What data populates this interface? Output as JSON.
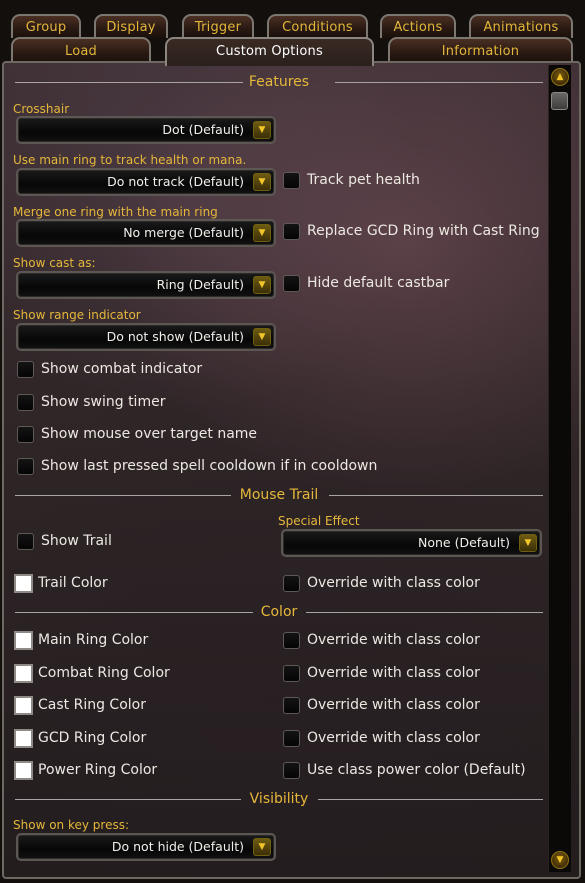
{
  "tabs": {
    "row1": [
      {
        "label": "Group"
      },
      {
        "label": "Display"
      },
      {
        "label": "Trigger"
      },
      {
        "label": "Conditions"
      },
      {
        "label": "Actions"
      },
      {
        "label": "Animations"
      }
    ],
    "row2": [
      {
        "label": "Load"
      },
      {
        "label": "Custom Options"
      },
      {
        "label": "Information"
      }
    ]
  },
  "sections": {
    "features": "Features",
    "mouse_trail": "Mouse Trail",
    "color": "Color",
    "visibility": "Visibility"
  },
  "features": {
    "crosshair": {
      "label": "Crosshair",
      "value": "Dot (Default)"
    },
    "main_ring_track": {
      "label": "Use main ring to track health or mana.",
      "value": "Do not track (Default)"
    },
    "track_pet_health": {
      "label": "Track pet health",
      "checked": false
    },
    "merge_ring": {
      "label": "Merge one ring with the main ring",
      "value": "No merge (Default)"
    },
    "replace_gcd": {
      "label": "Replace GCD Ring with Cast Ring",
      "checked": false
    },
    "show_cast_as": {
      "label": "Show cast as:",
      "value": "Ring (Default)"
    },
    "hide_castbar": {
      "label": "Hide default castbar",
      "checked": false
    },
    "range_indicator": {
      "label": "Show range indicator",
      "value": "Do not show (Default)"
    },
    "show_combat_indicator": {
      "label": "Show combat indicator",
      "checked": false
    },
    "show_swing_timer": {
      "label": "Show swing timer",
      "checked": false
    },
    "show_mouseover_name": {
      "label": "Show mouse over target name",
      "checked": false
    },
    "show_last_spell_cd": {
      "label": "Show last pressed spell cooldown if in cooldown",
      "checked": false
    }
  },
  "mouse_trail": {
    "show_trail": {
      "label": "Show Trail",
      "checked": false
    },
    "special_effect": {
      "label": "Special Effect",
      "value": "None (Default)"
    },
    "trail_color": {
      "label": "Trail Color",
      "color": "#ffffff"
    },
    "override_class": {
      "label": "Override with class color",
      "checked": false
    }
  },
  "color": {
    "rows": [
      {
        "label": "Main Ring Color",
        "color": "#ffffff",
        "option": "Override with class color"
      },
      {
        "label": "Combat Ring Color",
        "color": "#ffffff",
        "option": "Override with class color"
      },
      {
        "label": "Cast Ring Color",
        "color": "#ffffff",
        "option": "Override with class color"
      },
      {
        "label": "GCD Ring Color",
        "color": "#ffffff",
        "option": "Override with class color"
      },
      {
        "label": "Power Ring Color",
        "color": "#ffffff",
        "option": "Use class power color (Default)"
      }
    ]
  },
  "visibility": {
    "show_on_key_press": {
      "label": "Show on key press:",
      "value": "Do not hide (Default)"
    }
  },
  "icons": {
    "dropdown_arrow": "chevron-down-icon",
    "scroll_up": "scroll-up-icon",
    "scroll_down": "scroll-down-icon"
  },
  "colors": {
    "accent_gold": "#e5b73a",
    "text_white": "#ece8e2"
  }
}
